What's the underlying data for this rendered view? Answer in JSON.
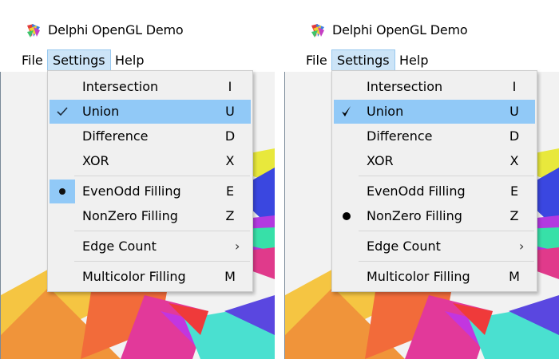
{
  "window": {
    "title": "Delphi OpenGL Demo"
  },
  "menubar": {
    "items": [
      "File",
      "Settings",
      "Help"
    ]
  },
  "settings_menu": {
    "items": [
      {
        "label": "Intersection",
        "shortcut": "I"
      },
      {
        "label": "Union",
        "shortcut": "U"
      },
      {
        "label": "Difference",
        "shortcut": "D"
      },
      {
        "label": "XOR",
        "shortcut": "X"
      },
      {
        "label": "EvenOdd Filling",
        "shortcut": "E"
      },
      {
        "label": "NonZero Filling",
        "shortcut": "Z"
      },
      {
        "label": "Edge Count",
        "shortcut": "›"
      },
      {
        "label": "Multicolor Filling",
        "shortcut": "M"
      }
    ]
  },
  "panes": [
    {
      "name": "left",
      "checked_item": "Union",
      "check_style": "flat-check",
      "radio_item": "EvenOdd Filling",
      "radio_boxed": true
    },
    {
      "name": "right",
      "checked_item": "Union",
      "check_style": "classic-check",
      "radio_item": "NonZero Filling",
      "radio_boxed": false
    }
  ],
  "colors": {
    "highlight": "#91c9f7",
    "menu_bg": "#f0f0f0",
    "settings_active": "#cce4f7"
  }
}
